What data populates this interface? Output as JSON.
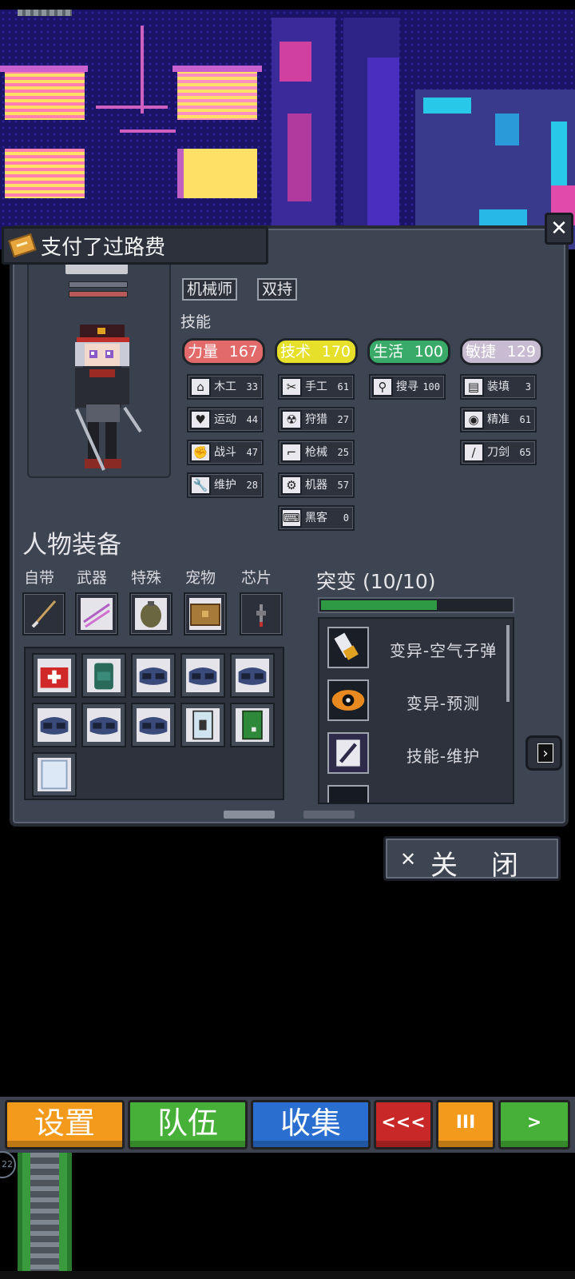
{
  "title": "支付了过路费",
  "character": {
    "tags": [
      "机械师",
      "双持"
    ],
    "skills_title": "技能"
  },
  "stats": [
    {
      "name": "力量",
      "value": "167",
      "color": "#e26a6a"
    },
    {
      "name": "技术",
      "value": "170",
      "color": "#e6e02a"
    },
    {
      "name": "生活",
      "value": "100",
      "color": "#3aaa68"
    },
    {
      "name": "敏捷",
      "value": "129",
      "color": "#c9bcd2"
    }
  ],
  "skills": {
    "col1": [
      {
        "icon": "house-icon",
        "glyph": "⌂",
        "label": "木工",
        "value": "33"
      },
      {
        "icon": "heart-icon",
        "glyph": "♥",
        "label": "运动",
        "value": "44"
      },
      {
        "icon": "fist-icon",
        "glyph": "✊",
        "label": "战斗",
        "value": "47"
      },
      {
        "icon": "wrench-icon",
        "glyph": "🔧",
        "label": "维护",
        "value": "28"
      }
    ],
    "col2": [
      {
        "icon": "scissors-icon",
        "glyph": "✂",
        "label": "手工",
        "value": "61"
      },
      {
        "icon": "radiation-icon",
        "glyph": "☢",
        "label": "狩猎",
        "value": "27"
      },
      {
        "icon": "gun-icon",
        "glyph": "⌐",
        "label": "枪械",
        "value": "25"
      },
      {
        "icon": "gear-icon",
        "glyph": "⚙",
        "label": "机器",
        "value": "57"
      },
      {
        "icon": "hacker-icon",
        "glyph": "⌨",
        "label": "黑客",
        "value": "0"
      }
    ],
    "col3": [
      {
        "icon": "magnifier-icon",
        "glyph": "⚲",
        "label": "搜寻",
        "value": "100"
      }
    ],
    "col4": [
      {
        "icon": "magazine-icon",
        "glyph": "▤",
        "label": "装填",
        "value": "3"
      },
      {
        "icon": "eye-icon",
        "glyph": "◉",
        "label": "精准",
        "value": "61"
      },
      {
        "icon": "blade-icon",
        "glyph": "/",
        "label": "刀剑",
        "value": "65"
      }
    ]
  },
  "equipment": {
    "title": "人物装备",
    "slot_labels": [
      "自带",
      "武器",
      "特殊",
      "宠物",
      "芯片"
    ],
    "slots": [
      "spear-icon",
      "dual-blades-icon",
      "grenade-icon",
      "crate-icon",
      "chip-icon"
    ],
    "inventory": [
      "medkit-icon",
      "backpack-icon",
      "goggles-icon",
      "goggles-icon",
      "goggles-icon",
      "goggles-icon",
      "goggles-icon",
      "goggles-icon",
      "book-icon",
      "green-book-icon",
      "cloth-icon"
    ]
  },
  "mutation": {
    "title": "突变 (10/10)",
    "progress": 0.6,
    "items": [
      {
        "icon": "bullet-icon",
        "label": "变异-空气子弹"
      },
      {
        "icon": "eye-icon",
        "label": "变异-预测"
      },
      {
        "icon": "wrench-icon",
        "label": "技能-维护"
      }
    ]
  },
  "close_label": "关闭",
  "toolbar": [
    {
      "label": "设置",
      "color": "#f39a1c"
    },
    {
      "label": "队伍",
      "color": "#46b038"
    },
    {
      "label": "收集",
      "color": "#2a6fd0"
    },
    {
      "label": "<<<",
      "color": "#c82828"
    },
    {
      "label": "III",
      "color": "#f39a1c"
    },
    {
      "label": ">",
      "color": "#46b038"
    }
  ]
}
